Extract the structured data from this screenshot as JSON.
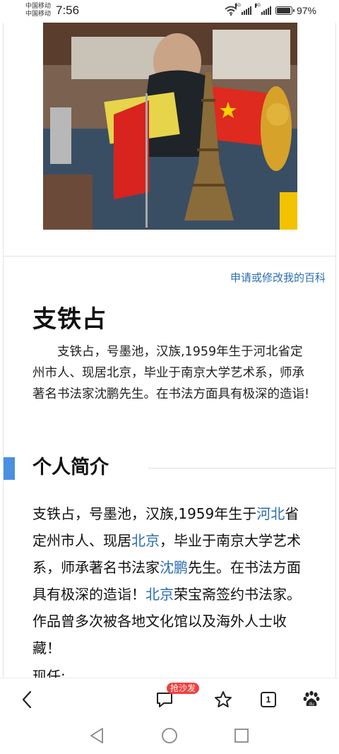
{
  "status_bar": {
    "carrier_1": "中国移动",
    "carrier_2": "中国移动",
    "time": "7:56",
    "network_1": "5G",
    "network_2": "4G",
    "battery": "97%",
    "battery_level": 0.97,
    "icons": [
      "wifi-icon",
      "signal-icon",
      "signal-icon",
      "battery-icon"
    ]
  },
  "article": {
    "edit_link": "申请或修改我的百科",
    "title": "支铁占",
    "summary": "支铁占，号墨池，汉族,1959年生于河北省定州市人、现居北京，毕业于南京大学艺术系，师承著名书法家沈鹏先生。在书法方面具有极深的造诣!",
    "section_title": "个人简介",
    "body": {
      "t1": "支铁占，号墨池，汉族,1959年生于",
      "link_1": "河北",
      "t2": "省定州市人、现居",
      "link_2": "北京",
      "t3": "，毕业于南京大学艺术系，师承著名书法家",
      "link_3": "沈鹏",
      "t4": "先生。在书法方面具有极深的造诣！",
      "link_4": "北京",
      "t5": "荣宝斋签约书法家。作品曾多次被各地文化馆以及海外人士收藏！"
    },
    "trailing_text": "现任:"
  },
  "toolbar": {
    "comment_badge": "抢沙发",
    "tab_count": "1",
    "icons": [
      "back-icon",
      "comment-icon",
      "star-icon",
      "tabs-icon",
      "baidu-paw-icon"
    ]
  },
  "nav_bar": {
    "icons": [
      "nav-back-icon",
      "nav-home-icon",
      "nav-recents-icon"
    ]
  }
}
